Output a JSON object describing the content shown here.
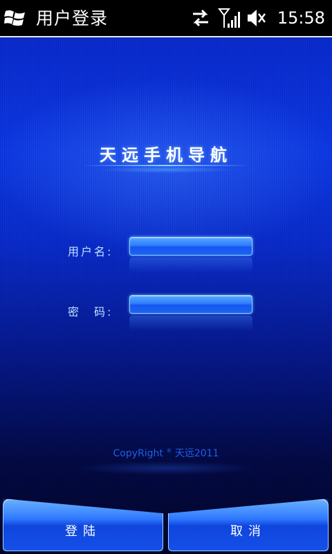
{
  "status_bar": {
    "app_title": "用户登录",
    "time": "15:58",
    "icons": [
      "windows-start-icon",
      "data-sync-icon",
      "signal-strength-icon",
      "volume-mute-icon"
    ]
  },
  "main": {
    "brand_title": "天远手机导航",
    "username_label": "用户名:",
    "password_label": "密　码:",
    "username_value": "",
    "password_value": "",
    "copyright_prefix": "CopyRight",
    "copyright_symbol": "®",
    "copyright_suffix": "天远2011"
  },
  "softkeys": {
    "login_label": "登陆",
    "cancel_label": "取消"
  },
  "colors": {
    "status_bar_bg": "#000000",
    "background_top": "#0d38e6",
    "background_bottom": "#02052a",
    "label_text": "#bfe3ff",
    "copyright_text": "#1f5fe6",
    "input_accent": "#2f7dff"
  }
}
